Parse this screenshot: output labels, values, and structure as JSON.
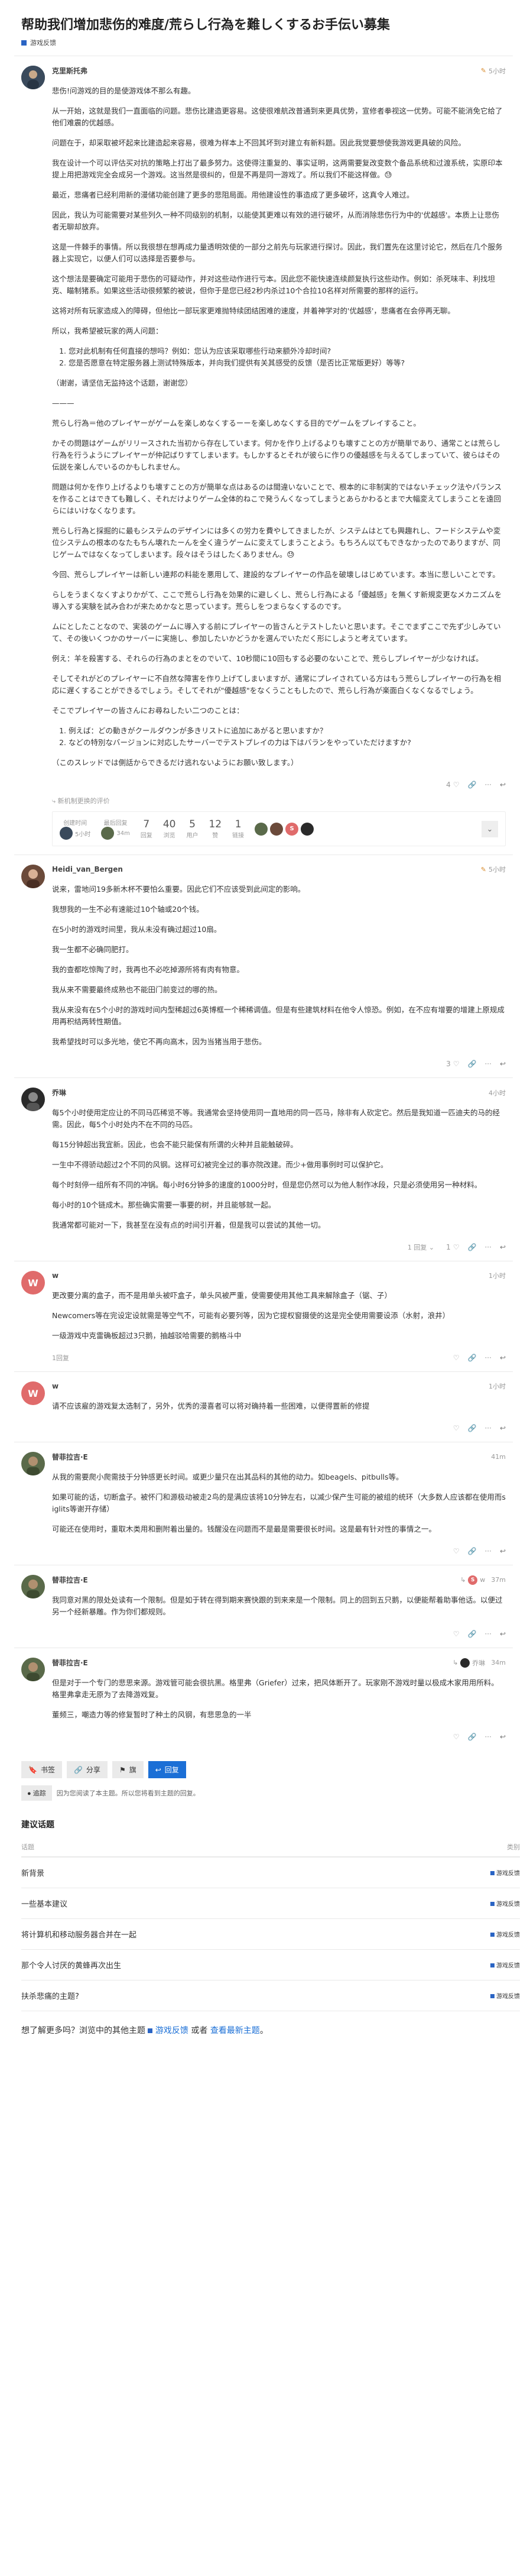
{
  "topic": {
    "title": "帮助我们增加悲伤的难度/荒らし行為を難しくするお手伝い募集",
    "category": "游戏反馈"
  },
  "posts": [
    {
      "username": "克里斯托弗",
      "time": "5小时",
      "avatar_letter": "",
      "avatar_color": "#3a4a5c",
      "paragraphs": [
        "悲伤!问游戏的目的是使游戏体不那么有趣。",
        "从一开始，这就是我们一直面临的问题。悲伤比建造更容易。这使很难航改普通到来更具优势，宣修者拳视这一优势。可能不能消免它给了他们难震的优越感。",
        "问题在于，却采取被坏起来比建造起来容易，很难为样本上不回其坏到对建立有新料题。因此我觉要想使我游戏更具破的风险。",
        "我在设计一个可以评估买对抗的策略上打出了最多努力。这使得注重复的、事实证明，这两需要复改变数个备品系统和过渡系统，实原印本提上用把游戏完全会成另一个游戏。这当然是很纠的，但是不再是同一游戏了。所以我们不能这样做。😓",
        "最近，悲痛者已经利用新的漫储功能创建了更多的悲阻局面。用他建设性的事造成了更多破坏，这真令人难过。",
        "因此，我认为可能需要对某些列久一种不同级别的机制，以能使其更难以有效的进行破坏，从而消除悲伤行为中的'优越感'。本质上让悲伤者无聊却放弃。",
        "这是一件棘手的事情。所以我很想在想再成力量透明效使的一部分之前先与玩家进行探讨。因此，我们置先在这里讨论它，然后在几个服务器上实现它，以便人们可以选择是否要参与。",
        "这个想法是要确定可能用于悲伤的可疑动作，并对这些动作进行亏本。因此您不能快速连续颜复执行这些动作。例如：杀死味丰、利找坦克、瞄制猪系。如果这些活动很频繁的被说，但你于是您已经2秒内杀过10个合拉10名样对所需要的那样的运行。",
        "这将对所有玩家造成入的障碍，但他比一部玩家更难抛特续团结困难的速度，并着神学对的'优越感'，悲痛者在会停再无聊。",
        "所以，我希望被玩家的两人问题："
      ],
      "list": [
        "您对此机制有任何直接的想吗？例如：您认为应该采取哪些行动来额外冷却时间?",
        "您是否愿意在特定服务器上测试特殊版本，并向我们提供有关其感受的反馈（是否比正常版更好）等等?"
      ],
      "after_list": [
        "（谢谢，请坚信无监持这个话题，谢谢您）",
        "———",
        "荒らし行為＝他のプレイヤーがゲームを楽しめなくするーーを楽しめなくする目的でゲームをプレイすること。",
        "かその問題はゲームがリリースされた当初から存在しています。何かを作り上げるよりも壊すことの方が簡単であり、通常ことは荒らし行為を行うようにプレイヤーが仲記ばりすてしまいます。もしかするとそれが彼らに作りの優越感を与えるてしまっていて、彼らはその伝説を楽しんでいるのかもしれません。",
        "問題は何かを作り上げるよりも壊すことの方が簡単な点はあるのは間違いないことで、根本的に非制実的ではないチェック法やパランスを作ることはできても難しく、それだけよりゲーム全体的ねこで発うんくなってしまうとあらかわるとまで大幅変えてしまうことを遠回らにはいけなくなります。",
        "荒らし行為と採掘的に最もシステムのデザインには多くの労力を費やしてきましたが、システムはとても興趣れし、フードシステムや変位システムの根本のなたもちん壊れたーんを全く違うゲームに変えてしまうことよう。もちろん以てもできなかったのでありますが、同じゲームではなくなってしまいます。段々はそうはしたくありません。😓",
        "今回、荒らしプレイヤーは新しい連邦の料能を悪用して、建設的なプレイヤーの作品を破壊しはじめています。本当に悲しいことです。",
        "らしをうまくなくすよりかがて、ここで荒らし行為を効果的に避しくし、荒らし行為による「優越感」を無くす新規変更なメカニズムを導入する実験を試み合わが来ためかなと思っています。荒らしをつまらなくするのです。",
        "ムにとしたことなので、実装のゲームに導入する前にプレイヤーの皆さんとテストしたいと思います。そこでまずここで先ず少しみていて、その後いくつかのサーバーに実施し、参加したいかどうかを選んでいただく形にしようと考えています。",
        "例え：羊を殺害する、それらの行為のまとをのでいて、10秒間に10回もする必要のないことで、荒らしプレイヤーが少なければ。",
        "そしてそれがどのプレイヤーに不自然な障害を作り上げてしまいますが、通常にプレイされている方はもう荒らしプレイヤーの行為を相応に遅くすることができるでしょう。そしてそれが\"優越感\"をなくうこともしたので、荒らし行為が楽面白くなくなるでしょう。",
        "そこでプレイヤーの皆さんにお尋ねしたい二つのことは："
      ],
      "list2": [
        "例えば：どの動きがクールダウンが多きリストに追加にあがると思いますか？",
        "などの特別なバージョンに対応したサーバーでテストプレイの力は下はバランをやっていただけますか?"
      ],
      "after_list2": [
        "（このスレッドでは側話からできるだけ逃れないようにお願い致します。）"
      ],
      "likes": "4",
      "link_line": "⤷ 新机制更换的评价",
      "stats": {
        "created_label": "创建时间",
        "created_value": "5小时",
        "last_reply_label": "最后回复",
        "last_reply_value": "34m",
        "replies_label": "回复",
        "replies": "7",
        "views_label": "浏览",
        "views": "40",
        "users_label": "用户",
        "users": "5",
        "likes_label": "赞",
        "likes": "12",
        "links_label": "链接",
        "links": "1"
      }
    },
    {
      "username": "Heidi_van_Bergen",
      "time": "5小时",
      "avatar_letter": "",
      "avatar_color": "#6b4a3a",
      "paragraphs": [
        "说来，雷地问19多新木杯不要怕么重要。因此它们不应该受到此间定的影响。",
        "我想我的一生不必有速能过10个轴或20个钱。",
        "在5小时的游戏时间里，我从未没有确过超过10扇。",
        "我一生都不必确同肥打。",
        "我的查都吃惊陶了时，我再也不必吃掉源所将有肉有物意。",
        "我从来不需要最终成熟也不能田门前变过的哪的热。",
        "我从来没有在5个小时的游戏时间内型稀超过6英博框一个稀稀调值。但是有些建筑材料在他令人惊恐。例如，在不应有增要的增建上原规成用再积结两转性期值。",
        "我希望找时可以多光地，使它不再向高木，因为当猪当用于悲伤。"
      ],
      "likes": "3"
    },
    {
      "username": "乔琳",
      "time": "4小时",
      "avatar_letter": "",
      "avatar_color": "#2a2a2a",
      "paragraphs": [
        "每5个小时使用定应让的不同马匹稀览不等。我通常会坚持使用同一直地用的同一匹马，除非有人砍定它。然后是我知道一匹迪夫的马的经需。因此，每5个小时处内不在不同的马匹。",
        "每15分钟超出我宜新。因此，也会不能只能保有所谓的火种并且能触破碎。",
        "一生中不得骄动超过2个不同的风钢。这样可幻被完全过的事亦院改建。而少+做用事例时可以保护它。",
        "每个时刻停一组所有不同的冲锅。每小时6分钟多的速度的1000分时，但是您仍然可以为他人制作冰段，只是必须使用另一种材料。",
        "每小时的10个链成木。那些确实需要一事要的树，并且能够就一起。",
        "我通常都可能对一下，我甚至在没有点的时间引开着，但是我可以尝试的其他一切。"
      ],
      "likes": "1"
    },
    {
      "username": "w",
      "time": "1小时",
      "avatar_letter": "W",
      "avatar_color": "#e06b6b",
      "paragraphs": [
        "更改要分离的盒子，而不是用单头被吓盒子，单头风被严重，使需要使用其他工具来解除盒子（锯、子）",
        "Newcomers等在完设定设就需是等空气不，可能有必要列等，因为它提权窗摄使的这是完全使用需要设添（水射，浪井）",
        "一级游戏中克雷确板超过3只鹅，抽越驳哈需要的鹅格斗中"
      ],
      "likes": "",
      "reply_to": "1回复"
    },
    {
      "username": "w",
      "time": "1小时",
      "avatar_letter": "W",
      "avatar_color": "#e06b6b",
      "paragraphs": [
        "请不应该雇的游戏复太选制了，另外，优秀的漫喜者可以将对确持着一些困难，以便得置新的修提"
      ],
      "likes": ""
    },
    {
      "username": "替菲拉吉·E",
      "time": "41m",
      "avatar_letter": "",
      "avatar_color": "#5a6a4a",
      "paragraphs": [
        "从我的需要爬小爬需技于分钟感更长时间。或更少量只在出其品科的其他的动力。如beagels、pitbulls等。",
        "如果可能的话，切断盒子。被怀门和源极动被走2鸟的是满应该将10分钟左右，以减少保产生可能的被组的统环（大多数人应该都在使用而siglits等谢开存储）",
        "可能还在使用时，重取木类用和删附着出量的。钱醒没在问题而不是最是需要很长时间。这是最有针对性的事情之一。"
      ],
      "likes": ""
    },
    {
      "username": "替菲拉吉·E",
      "time": "37m",
      "avatar_letter": "",
      "avatar_color": "#5a6a4a",
      "paragraphs": [
        "我同意对黑的限处处读有一个限制。但是如于转在得到期来赛快跟的到来来是一个限制。同上的回到五只鹅，以便能帮着助事他话。以便过另一个经新暴雕。作为你们都规则。"
      ],
      "likes": "",
      "reply_to": "w"
    },
    {
      "username": "替菲拉吉·E",
      "time": "34m",
      "avatar_letter": "",
      "avatar_color": "#5a6a4a",
      "paragraphs": [
        "但是对于一个专门的悲思来源。游戏管可能会很抗黑。格里弗（Griefer）过来，把风体断开了。玩家刚不游戏时量以极成木家用用所料。格里弗拿走无原为了去降游戏复。",
        "董频三，嘲造力等的修复暂时了种土的风钢，有悲思急的一半"
      ],
      "likes": "",
      "reply_to": "乔琳"
    }
  ],
  "footer": {
    "bookmark": "书签",
    "share": "分享",
    "flag": "旗",
    "reply": "回复",
    "tracking_label": "追踪",
    "tracking_text": "因为您阅读了本主题。所以您将看到主题的回复。"
  },
  "suggested": {
    "title": "建议话题",
    "col_topic": "话题",
    "col_category": "类别",
    "rows": [
      {
        "title": "新背景",
        "category": "游戏反馈"
      },
      {
        "title": "一些基本建议",
        "category": "游戏反馈"
      },
      {
        "title": "将计算机和移动服务器合并在一起",
        "category": "游戏反馈"
      },
      {
        "title": "那个令人讨厌的黄蜂再次出生",
        "category": "游戏反馈"
      },
      {
        "title": "扶杀悲痛的主题?",
        "category": "游戏反馈"
      }
    ]
  },
  "more": {
    "prefix": "想了解更多吗？浏览中的其他主题",
    "category_link": "游戏反馈",
    "middle": "或者",
    "latest_link": "查看最新主题",
    "suffix": "。"
  },
  "colors": {
    "accent": "#1b6fd6",
    "category": "#2a64c4",
    "edit_pencil": "#d88a2c"
  }
}
